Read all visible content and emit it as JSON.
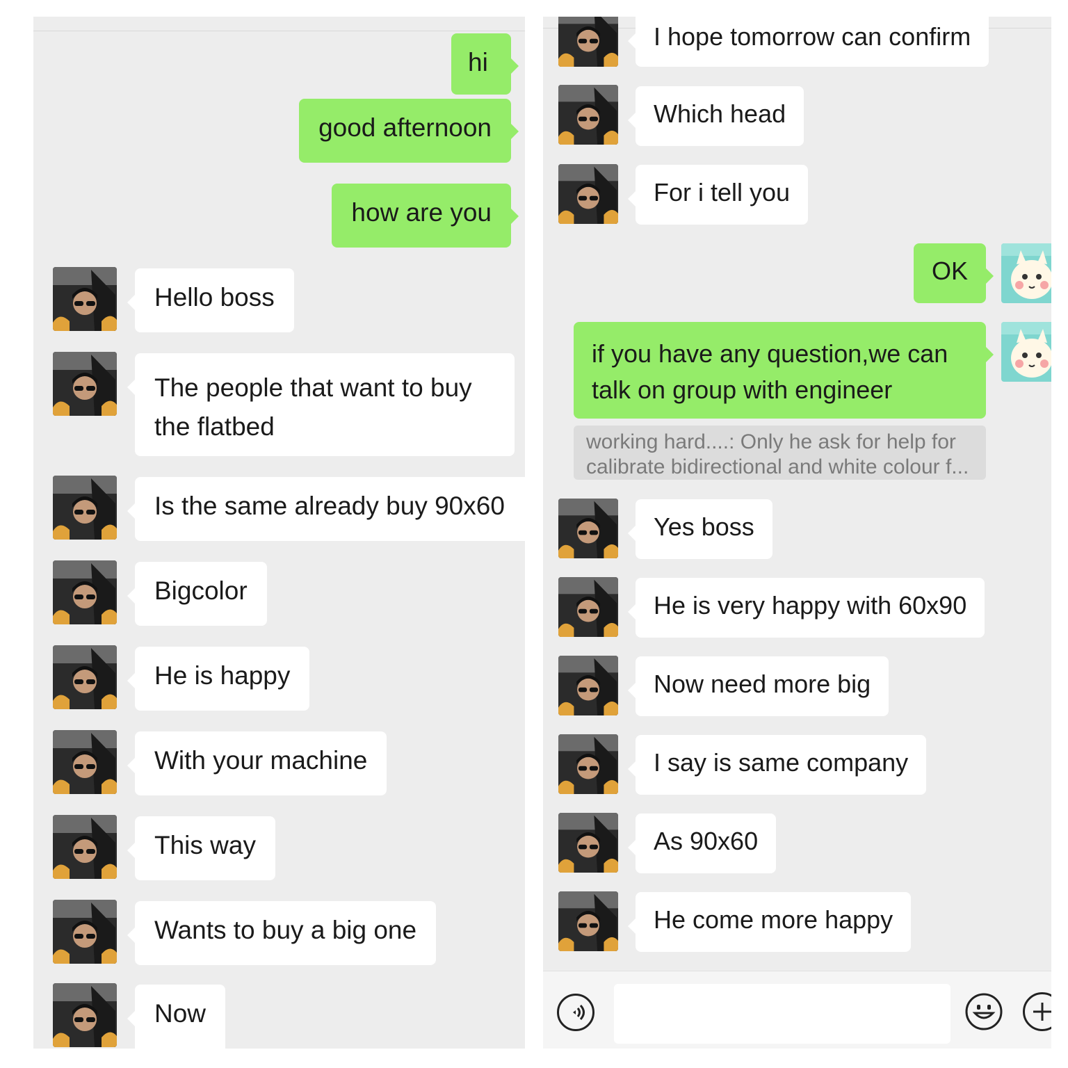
{
  "left": {
    "messages": [
      {
        "dir": "out",
        "text": "hi"
      },
      {
        "dir": "out",
        "text": "good afternoon"
      },
      {
        "dir": "out",
        "text": "how are you"
      },
      {
        "dir": "in",
        "text": "Hello boss"
      },
      {
        "dir": "in",
        "text": "The people that want to buy the flatbed"
      },
      {
        "dir": "in",
        "text": "Is the same already buy 90x60"
      },
      {
        "dir": "in",
        "text": "Bigcolor"
      },
      {
        "dir": "in",
        "text": "He is happy"
      },
      {
        "dir": "in",
        "text": "With your machine"
      },
      {
        "dir": "in",
        "text": "This way"
      },
      {
        "dir": "in",
        "text": "Wants to buy a big one"
      },
      {
        "dir": "in",
        "text": "Now"
      }
    ]
  },
  "right": {
    "messages": [
      {
        "dir": "in",
        "text": "I hope tomorrow can confirm"
      },
      {
        "dir": "in",
        "text": "Which head"
      },
      {
        "dir": "in",
        "text": "For i tell you"
      },
      {
        "dir": "out",
        "text": "OK"
      },
      {
        "dir": "out",
        "text": "if you have any question,we can talk on group with engineer"
      },
      {
        "dir": "in",
        "text": "Yes boss"
      },
      {
        "dir": "in",
        "text": "He is very happy with 60x90"
      },
      {
        "dir": "in",
        "text": "Now need more big"
      },
      {
        "dir": "in",
        "text": "I say is same company"
      },
      {
        "dir": "in",
        "text": "As 90x60"
      },
      {
        "dir": "in",
        "text": "He come more happy"
      }
    ],
    "quote": {
      "line1": "working hard....:  Only he ask for help for",
      "line2": "calibrate bidirectional and white colour f..."
    }
  },
  "input_bar": {
    "voice_icon": "voice-icon",
    "emoji_icon": "emoji-icon",
    "plus_icon": "plus-icon"
  },
  "colors": {
    "chat_bg": "#ededed",
    "incoming_bubble": "#ffffff",
    "outgoing_bubble": "#95ec69",
    "quote_bg": "#dcdcdc"
  }
}
